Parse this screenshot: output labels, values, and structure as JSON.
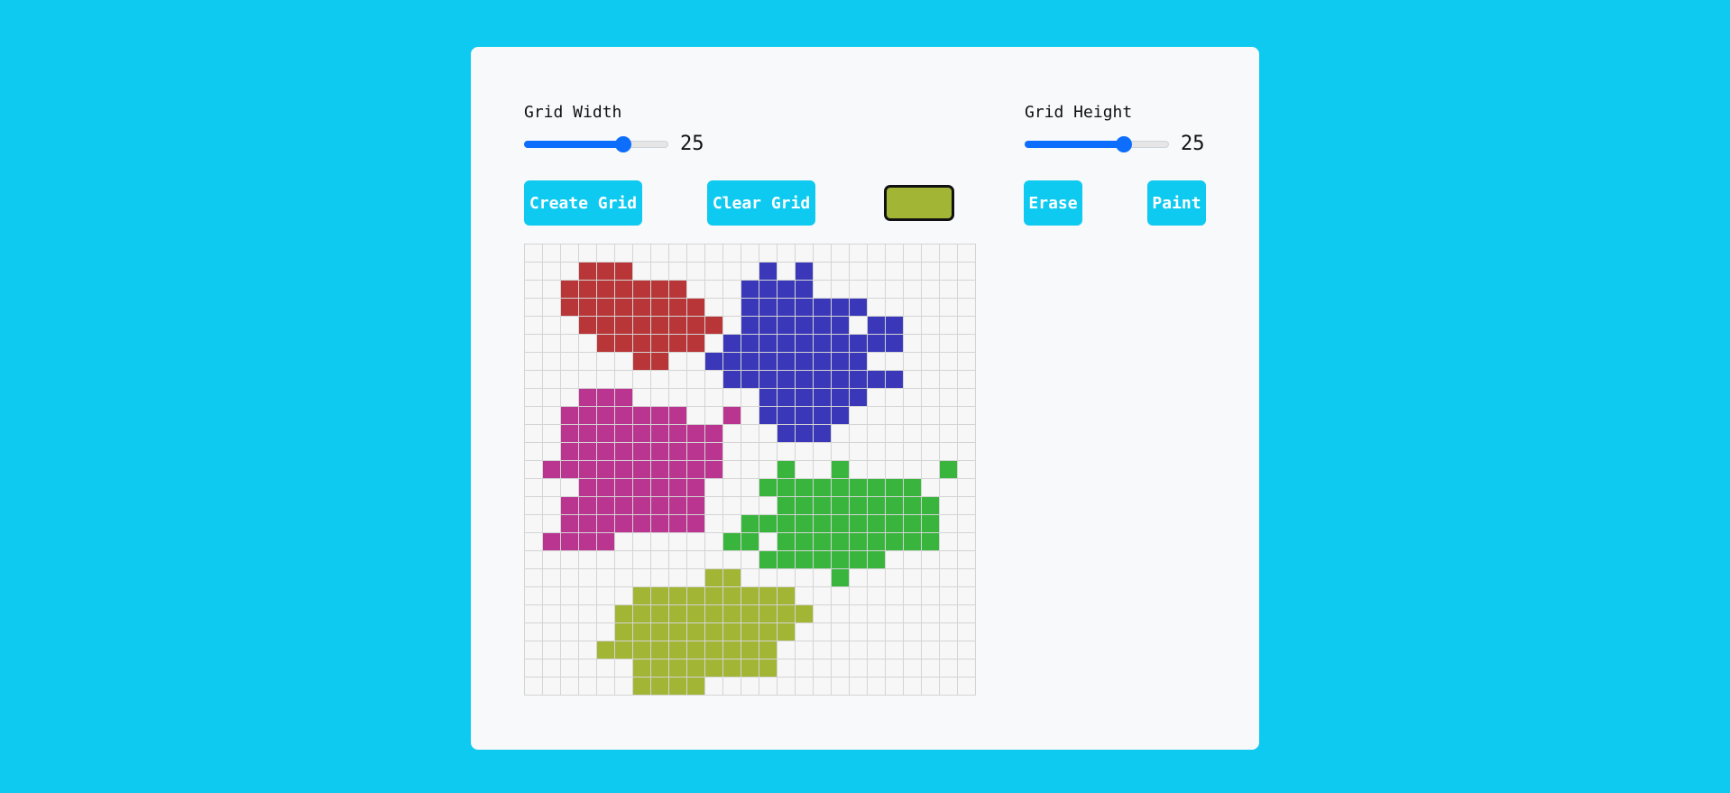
{
  "controls": {
    "width": {
      "label": "Grid Width",
      "value": "25",
      "min": 1,
      "max": 35,
      "level": 0.69
    },
    "height": {
      "label": "Grid Height",
      "value": "25",
      "min": 1,
      "max": 35,
      "level": 0.69
    }
  },
  "buttons": {
    "create": "Create Grid",
    "clear": "Clear Grid",
    "erase": "Erase",
    "paint": "Paint"
  },
  "current_color": "#a2b535",
  "colors": {
    "background": "#0ecaf0",
    "accent": "#0d6efd",
    "empty_cell": "#f7f7f7",
    "grid_line": "#d4d4d4"
  },
  "palette": {
    "R": "#b83637",
    "B": "#3a38b8",
    "M": "#b93590",
    "G": "#39b53e",
    "Y": "#a2b535"
  },
  "grid": {
    "cols": 25,
    "rows": 25,
    "cells": [
      ".........................",
      "...RRR.......B.B.........",
      "..RRRRRRR...BBBB.........",
      "..RRRRRRRR..BBBBBBB......",
      "...RRRRRRRR.BBBBBB.BB....",
      "....RRRRRR.BBBBBBBBBB....",
      "......RR..BBBBBBBBB......",
      "...........BBBBBBBBBB....",
      "...MMM.......BBBBBB......",
      "..MMMMMMM..M.BBBBB.......",
      "..MMMMMMMMM...BBB........",
      "..MMMMMMMMM..............",
      ".MMMMMMMMMM...G..G.....G.",
      "...MMMMMMM...GGGGGGGGG...",
      "..MMMMMMMM....GGGGGGGGG..",
      "..MMMMMMMM..GGGGGGGGGGG..",
      ".MMMM......GG.GGGGGGGGG..",
      ".............GGGGGGG.....",
      "..........YY.....G.......",
      "......YYYYYYYYY..........",
      ".....YYYYYYYYYYY.........",
      ".....YYYYYYYYYY..........",
      "....YYYYYYYYYY...........",
      "......YYYYYYYY...........",
      "......YYYY..............."
    ]
  }
}
